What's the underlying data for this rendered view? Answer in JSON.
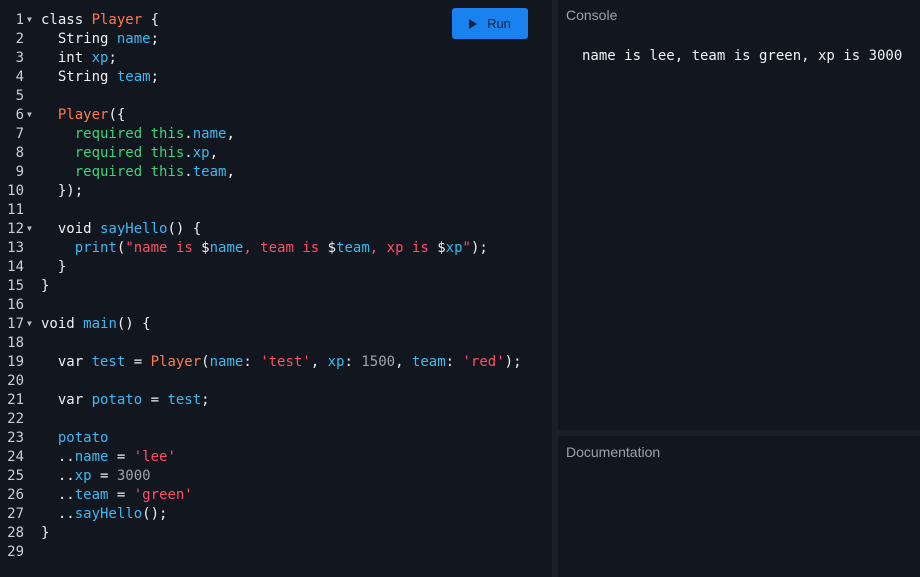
{
  "toolbar": {
    "run_label": "Run",
    "run_icon": "play-icon"
  },
  "editor": {
    "fold_icon": "fold-arrow-icon",
    "lines": [
      {
        "n": "1",
        "fold": true,
        "t": [
          [
            "plain",
            "class "
          ],
          [
            "cls",
            "Player"
          ],
          [
            "plain",
            " {"
          ]
        ]
      },
      {
        "n": "2",
        "fold": false,
        "t": [
          [
            "plain",
            "  String "
          ],
          [
            "fld",
            "name"
          ],
          [
            "plain",
            ";"
          ]
        ]
      },
      {
        "n": "3",
        "fold": false,
        "t": [
          [
            "plain",
            "  int "
          ],
          [
            "fld",
            "xp"
          ],
          [
            "plain",
            ";"
          ]
        ]
      },
      {
        "n": "4",
        "fold": false,
        "t": [
          [
            "plain",
            "  String "
          ],
          [
            "fld",
            "team"
          ],
          [
            "plain",
            ";"
          ]
        ]
      },
      {
        "n": "5",
        "fold": false,
        "t": []
      },
      {
        "n": "6",
        "fold": true,
        "t": [
          [
            "plain",
            "  "
          ],
          [
            "cls",
            "Player"
          ],
          [
            "plain",
            "({"
          ]
        ]
      },
      {
        "n": "7",
        "fold": false,
        "t": [
          [
            "plain",
            "    "
          ],
          [
            "kw",
            "required this"
          ],
          [
            "plain",
            "."
          ],
          [
            "fld",
            "name"
          ],
          [
            "plain",
            ","
          ]
        ]
      },
      {
        "n": "8",
        "fold": false,
        "t": [
          [
            "plain",
            "    "
          ],
          [
            "kw",
            "required this"
          ],
          [
            "plain",
            "."
          ],
          [
            "fld",
            "xp"
          ],
          [
            "plain",
            ","
          ]
        ]
      },
      {
        "n": "9",
        "fold": false,
        "t": [
          [
            "plain",
            "    "
          ],
          [
            "kw",
            "required this"
          ],
          [
            "plain",
            "."
          ],
          [
            "fld",
            "team"
          ],
          [
            "plain",
            ","
          ]
        ]
      },
      {
        "n": "10",
        "fold": false,
        "t": [
          [
            "plain",
            "  });"
          ]
        ]
      },
      {
        "n": "11",
        "fold": false,
        "t": []
      },
      {
        "n": "12",
        "fold": true,
        "t": [
          [
            "plain",
            "  void "
          ],
          [
            "fld",
            "sayHello"
          ],
          [
            "plain",
            "() {"
          ]
        ]
      },
      {
        "n": "13",
        "fold": false,
        "t": [
          [
            "plain",
            "    "
          ],
          [
            "fld",
            "print"
          ],
          [
            "plain",
            "("
          ],
          [
            "str",
            "\"name is "
          ],
          [
            "plain",
            "$"
          ],
          [
            "fld",
            "name"
          ],
          [
            "str",
            ", team is "
          ],
          [
            "plain",
            "$"
          ],
          [
            "fld",
            "team"
          ],
          [
            "str",
            ", xp is "
          ],
          [
            "plain",
            "$"
          ],
          [
            "fld",
            "xp"
          ],
          [
            "str",
            "\""
          ],
          [
            "plain",
            ");"
          ]
        ]
      },
      {
        "n": "14",
        "fold": false,
        "t": [
          [
            "plain",
            "  }"
          ]
        ]
      },
      {
        "n": "15",
        "fold": false,
        "t": [
          [
            "plain",
            "}"
          ]
        ]
      },
      {
        "n": "16",
        "fold": false,
        "t": []
      },
      {
        "n": "17",
        "fold": true,
        "t": [
          [
            "plain",
            "void "
          ],
          [
            "fld",
            "main"
          ],
          [
            "plain",
            "() {"
          ]
        ]
      },
      {
        "n": "18",
        "fold": false,
        "t": []
      },
      {
        "n": "19",
        "fold": false,
        "t": [
          [
            "plain",
            "  var "
          ],
          [
            "fld",
            "test"
          ],
          [
            "plain",
            " = "
          ],
          [
            "cls",
            "Player"
          ],
          [
            "plain",
            "("
          ],
          [
            "fld",
            "name"
          ],
          [
            "plain",
            ": "
          ],
          [
            "str",
            "'test'"
          ],
          [
            "plain",
            ", "
          ],
          [
            "fld",
            "xp"
          ],
          [
            "plain",
            ": "
          ],
          [
            "num",
            "1500"
          ],
          [
            "plain",
            ", "
          ],
          [
            "fld",
            "team"
          ],
          [
            "plain",
            ": "
          ],
          [
            "str",
            "'red'"
          ],
          [
            "plain",
            ");"
          ]
        ]
      },
      {
        "n": "20",
        "fold": false,
        "t": []
      },
      {
        "n": "21",
        "fold": false,
        "t": [
          [
            "plain",
            "  var "
          ],
          [
            "fld",
            "potato"
          ],
          [
            "plain",
            " = "
          ],
          [
            "fld",
            "test"
          ],
          [
            "plain",
            ";"
          ]
        ]
      },
      {
        "n": "22",
        "fold": false,
        "t": []
      },
      {
        "n": "23",
        "fold": false,
        "t": [
          [
            "plain",
            "  "
          ],
          [
            "fld",
            "potato"
          ]
        ]
      },
      {
        "n": "24",
        "fold": false,
        "t": [
          [
            "plain",
            "  .."
          ],
          [
            "fld",
            "name"
          ],
          [
            "plain",
            " = "
          ],
          [
            "str",
            "'lee'"
          ]
        ]
      },
      {
        "n": "25",
        "fold": false,
        "t": [
          [
            "plain",
            "  .."
          ],
          [
            "fld",
            "xp"
          ],
          [
            "plain",
            " = "
          ],
          [
            "num",
            "3000"
          ]
        ]
      },
      {
        "n": "26",
        "fold": false,
        "t": [
          [
            "plain",
            "  .."
          ],
          [
            "fld",
            "team"
          ],
          [
            "plain",
            " = "
          ],
          [
            "str",
            "'green'"
          ]
        ]
      },
      {
        "n": "27",
        "fold": false,
        "t": [
          [
            "plain",
            "  .."
          ],
          [
            "fld",
            "sayHello"
          ],
          [
            "plain",
            "();"
          ]
        ]
      },
      {
        "n": "28",
        "fold": false,
        "t": [
          [
            "plain",
            "}"
          ]
        ]
      },
      {
        "n": "29",
        "fold": false,
        "t": []
      }
    ]
  },
  "console": {
    "title": "Console",
    "output": "name is lee, team is green, xp is 3000"
  },
  "documentation": {
    "title": "Documentation"
  },
  "colors": {
    "accent": "#1a82f0",
    "class_name": "#ff7b4f",
    "identifier": "#3db8f0",
    "keyword": "#3fd27a",
    "string": "#ff4d66",
    "number": "#9aa4ad"
  }
}
